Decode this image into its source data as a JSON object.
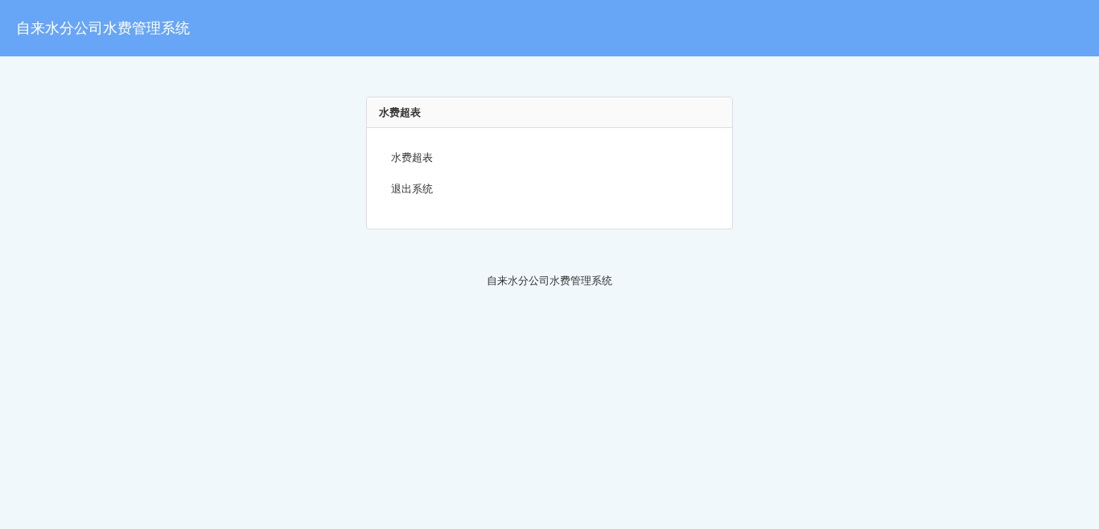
{
  "header": {
    "title": "自来水分公司水费管理系统"
  },
  "panel": {
    "title": "水费超表",
    "links": [
      "水费超表",
      "退出系统"
    ]
  },
  "footer": {
    "text": "自来水分公司水费管理系统"
  }
}
